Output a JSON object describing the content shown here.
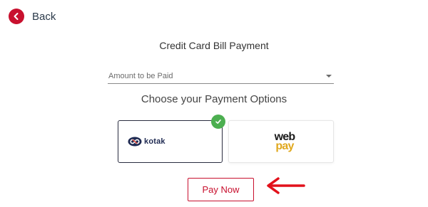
{
  "header": {
    "back_label": "Back"
  },
  "main": {
    "title": "Credit Card Bill Payment",
    "amount_field": {
      "placeholder": "Amount to be Paid"
    },
    "options_title": "Choose your Payment Options",
    "payment_options": [
      {
        "name": "kotak",
        "label": "kotak",
        "selected": true
      },
      {
        "name": "webpay",
        "label_top": "web",
        "label_bottom": "pay",
        "selected": false
      }
    ],
    "pay_button_label": "Pay Now"
  },
  "colors": {
    "brand_red": "#c8102e",
    "selected_check": "#4caf50",
    "kotak_navy": "#1f2a52",
    "webpay_gold": "#e0a81e"
  },
  "icons": [
    "back-arrow-icon",
    "check-icon",
    "kotak-logo-icon",
    "pointer-arrow-icon"
  ]
}
